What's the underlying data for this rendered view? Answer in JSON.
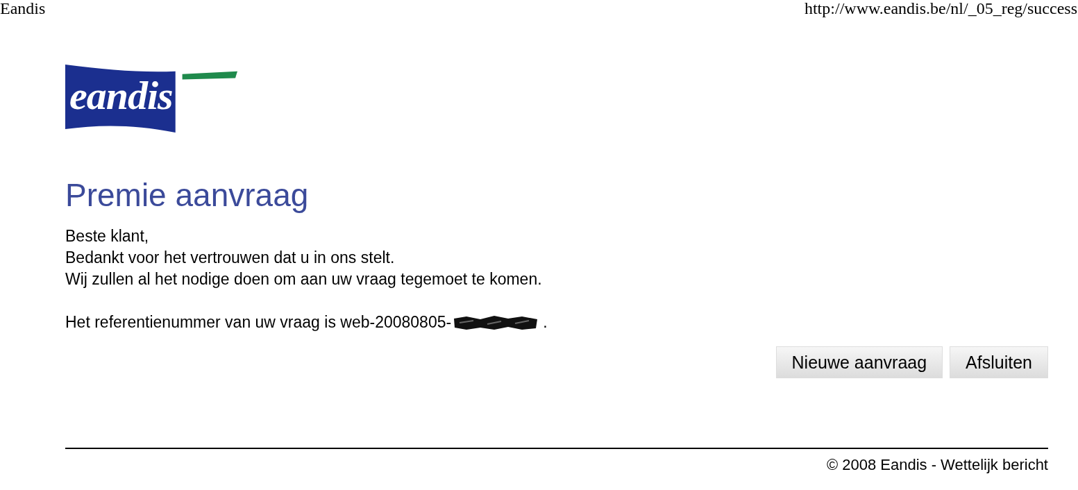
{
  "print_header": {
    "title": "Eandis",
    "url": "http://www.eandis.be/nl/_05_reg/success"
  },
  "logo": {
    "text": "eandis"
  },
  "heading": "Premie aanvraag",
  "message_lines": [
    "Beste klant,",
    "Bedankt voor het vertrouwen dat u in ons stelt.",
    "Wij zullen al het nodige doen om aan uw vraag tegemoet te komen."
  ],
  "reference": {
    "text": "Het referentienummer van uw vraag is web-20080805-",
    "suffix": "."
  },
  "buttons": [
    "Nieuwe aanvraag",
    "Afsluiten"
  ],
  "footer": "© 2008 Eandis - Wettelijk bericht"
}
